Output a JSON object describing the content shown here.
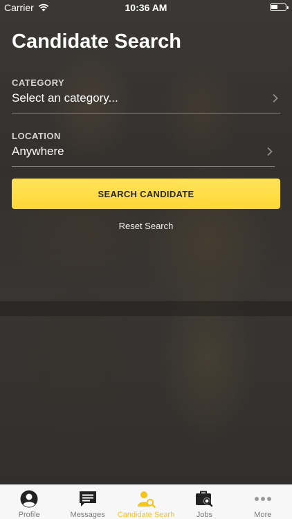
{
  "status_bar": {
    "carrier": "Carrier",
    "time": "10:36 AM"
  },
  "page": {
    "title": "Candidate Search"
  },
  "category": {
    "label": "CATEGORY",
    "value": "Select an category..."
  },
  "location": {
    "label": "LOCATION",
    "value": "Anywhere"
  },
  "actions": {
    "search_label": "SEARCH CANDIDATE",
    "reset_label": "Reset Search"
  },
  "colors": {
    "accent": "#fdd835",
    "tab_active": "#f5c518",
    "tab_inactive": "#7a7a7a",
    "icon_dark": "#222222"
  },
  "tabbar": {
    "items": [
      {
        "label": "Profile",
        "icon": "profile-icon",
        "active": false
      },
      {
        "label": "Messages",
        "icon": "messages-icon",
        "active": false
      },
      {
        "label": "Candidate Searh",
        "icon": "candidate-search-icon",
        "active": true
      },
      {
        "label": "Jobs",
        "icon": "jobs-icon",
        "active": false
      },
      {
        "label": "More",
        "icon": "more-icon",
        "active": false
      }
    ]
  }
}
